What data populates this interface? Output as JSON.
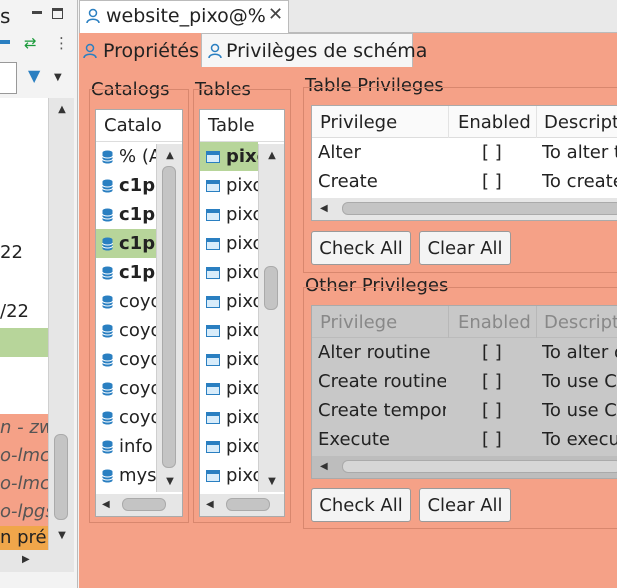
{
  "left_panel": {
    "tab_fragment": "s",
    "rows": [
      {
        "text": "22"
      },
      {
        "text": "/22"
      },
      {
        "text": "n",
        "suffix": "- zw"
      },
      {
        "text": "o-lmc"
      },
      {
        "text": "o-lmc"
      },
      {
        "text": "o-lpgs"
      },
      {
        "text": "n prér"
      }
    ]
  },
  "editor": {
    "tab_title": "website_pixo@%",
    "subtabs": [
      "Propriétés",
      "Privilèges de schéma"
    ]
  },
  "catalogs": {
    "title": "Catalogs",
    "column": "Catalo",
    "items": [
      {
        "label": "% (A",
        "bold": false,
        "selected": false
      },
      {
        "label": "c1pi",
        "bold": true,
        "selected": false
      },
      {
        "label": "c1pi",
        "bold": true,
        "selected": false
      },
      {
        "label": "c1pi",
        "bold": true,
        "selected": true
      },
      {
        "label": "c1pi",
        "bold": true,
        "selected": false
      },
      {
        "label": "coyo",
        "bold": false,
        "selected": false
      },
      {
        "label": "coyo",
        "bold": false,
        "selected": false
      },
      {
        "label": "coyo",
        "bold": false,
        "selected": false
      },
      {
        "label": "coyo",
        "bold": false,
        "selected": false
      },
      {
        "label": "coyo",
        "bold": false,
        "selected": false
      },
      {
        "label": "info",
        "bold": false,
        "selected": false
      },
      {
        "label": "mys",
        "bold": false,
        "selected": false
      }
    ]
  },
  "tables": {
    "title": "Tables",
    "column": "Table",
    "items": [
      {
        "label": "pixo",
        "bold": true,
        "selected": true
      },
      {
        "label": "pixo"
      },
      {
        "label": "pixo"
      },
      {
        "label": "pixo"
      },
      {
        "label": "pixo"
      },
      {
        "label": "pixo"
      },
      {
        "label": "pixo"
      },
      {
        "label": "pixo"
      },
      {
        "label": "pixo"
      },
      {
        "label": "pixo"
      },
      {
        "label": "pixo"
      },
      {
        "label": "pixo"
      }
    ]
  },
  "table_privileges": {
    "title": "Table Privileges",
    "headers": [
      "Privilege",
      "Enabled",
      "Descript"
    ],
    "rows": [
      {
        "privilege": "Alter",
        "enabled": "[ ]",
        "description": "To alter t"
      },
      {
        "privilege": "Create",
        "enabled": "[ ]",
        "description": "To create"
      }
    ],
    "check_all": "Check All",
    "clear_all": "Clear All"
  },
  "other_privileges": {
    "title": "Other Privileges",
    "headers": [
      "Privilege",
      "Enabled",
      "Descript"
    ],
    "rows": [
      {
        "privilege": "Alter routine",
        "enabled": "[ ]",
        "description": "To alter o"
      },
      {
        "privilege": "Create routine",
        "enabled": "[ ]",
        "description": "To use C"
      },
      {
        "privilege": "Create tempor",
        "enabled": "[ ]",
        "description": "To use C"
      },
      {
        "privilege": "Execute",
        "enabled": "[ ]",
        "description": "To execu"
      }
    ],
    "check_all": "Check All",
    "clear_all": "Clear All"
  },
  "colors": {
    "panel": "#f5a187",
    "selected": "#b7d59a",
    "accent": "#2a7fc1"
  }
}
